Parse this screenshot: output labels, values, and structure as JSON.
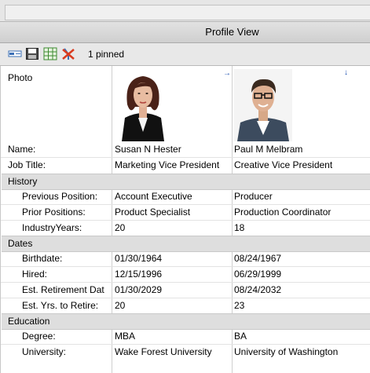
{
  "window": {
    "title": "Profile View"
  },
  "toolbar": {
    "icons": [
      "card-view-icon",
      "save-icon",
      "grid-view-icon",
      "clear-pins-icon"
    ],
    "pinned_label": "1 pinned"
  },
  "labels": {
    "photo": "Photo",
    "name": "Name:",
    "job_title": "Job Title:"
  },
  "groups": {
    "history": "History",
    "dates": "Dates",
    "education": "Education"
  },
  "fields": {
    "previous_position": "Previous Position:",
    "prior_positions": "Prior Positions:",
    "industry_years": "IndustryYears:",
    "birthdate": "Birthdate:",
    "hired": "Hired:",
    "est_retirement": "Est. Retirement Dat",
    "est_yrs_to_retire": "Est. Yrs. to Retire:",
    "degree": "Degree:",
    "university": "University:"
  },
  "profiles": [
    {
      "name": "Susan N Hester",
      "job_title": "Marketing Vice President",
      "previous_position": "Account Executive",
      "prior_positions": "Product Specialist",
      "industry_years": "20",
      "birthdate": "01/30/1964",
      "hired": "12/15/1996",
      "est_retirement": "01/30/2029",
      "est_yrs_to_retire": "20",
      "degree": "MBA",
      "university": "Wake Forest University",
      "pin_state": "pinned"
    },
    {
      "name": "Paul M Melbram",
      "job_title": "Creative Vice President",
      "previous_position": "Producer",
      "prior_positions": "Production Coordinator",
      "industry_years": "18",
      "birthdate": "08/24/1967",
      "hired": "06/29/1999",
      "est_retirement": "08/24/2032",
      "est_yrs_to_retire": "23",
      "degree": "BA",
      "university": "University of Washington",
      "pin_state": "unpinned"
    }
  ]
}
